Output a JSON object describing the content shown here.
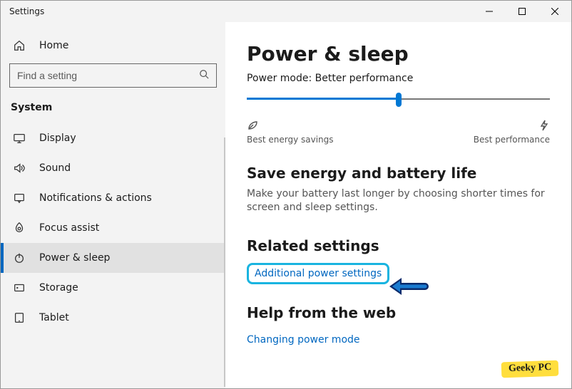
{
  "window": {
    "title": "Settings"
  },
  "sidebar": {
    "home_label": "Home",
    "search_placeholder": "Find a setting",
    "section_label": "System",
    "items": [
      {
        "key": "display",
        "label": "Display"
      },
      {
        "key": "sound",
        "label": "Sound"
      },
      {
        "key": "notifications",
        "label": "Notifications & actions"
      },
      {
        "key": "focus-assist",
        "label": "Focus assist"
      },
      {
        "key": "power-sleep",
        "label": "Power & sleep",
        "selected": true
      },
      {
        "key": "storage",
        "label": "Storage"
      },
      {
        "key": "tablet",
        "label": "Tablet"
      }
    ]
  },
  "main": {
    "heading": "Power & sleep",
    "power_mode_label": "Power mode: Better performance",
    "slider": {
      "position_percent": 50,
      "left_label": "Best energy savings",
      "right_label": "Best performance"
    },
    "save_energy": {
      "heading": "Save energy and battery life",
      "body": "Make your battery last longer by choosing shorter times for screen and sleep settings."
    },
    "related": {
      "heading": "Related settings",
      "link": "Additional power settings"
    },
    "help": {
      "heading": "Help from the web",
      "link": "Changing power mode"
    }
  },
  "watermark": "Geeky PC"
}
